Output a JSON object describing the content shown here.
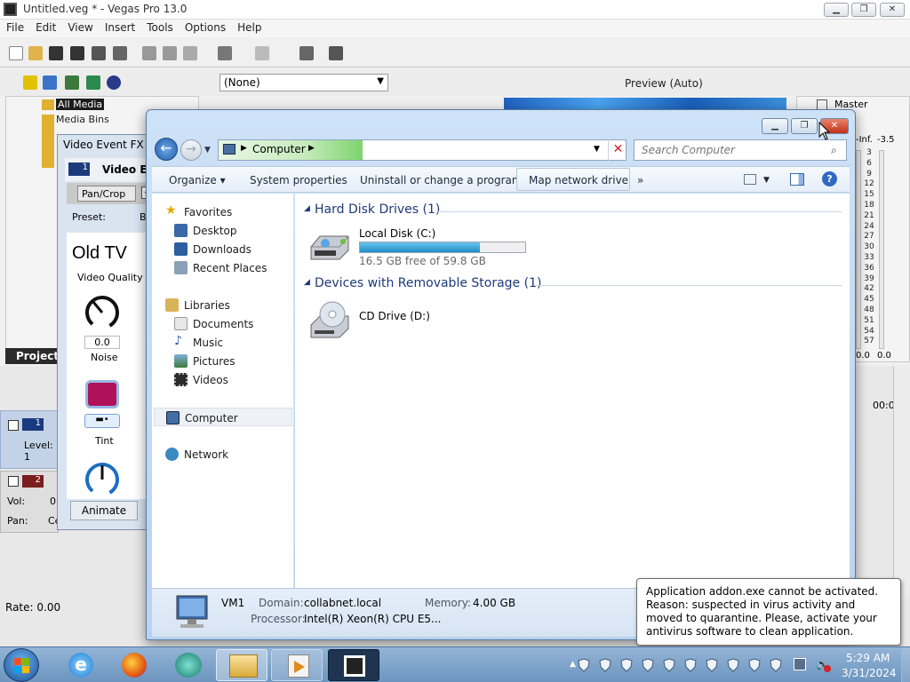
{
  "vegas": {
    "title": "Untitled.veg * - Vegas Pro 13.0",
    "menu": [
      "File",
      "Edit",
      "View",
      "Insert",
      "Tools",
      "Options",
      "Help"
    ],
    "fx_preset": "(None)",
    "preview_label": "Preview (Auto)",
    "master_label": "Master",
    "media_tree": [
      "All Media",
      "Media Bins"
    ],
    "project_tab": "Project",
    "rate_label": "Rate: 0.00",
    "meter_top": [
      "-Inf.",
      "-3.5"
    ],
    "meter_scale": [
      "3",
      "6",
      "9",
      "12",
      "15",
      "18",
      "21",
      "24",
      "27",
      "30",
      "33",
      "36",
      "39",
      "42",
      "45",
      "48",
      "51",
      "54",
      "57"
    ],
    "meter_bottom": [
      "0.0",
      "0.0"
    ],
    "timecode": "00:0",
    "tracks": [
      {
        "num": "1",
        "label": "Level: 1"
      },
      {
        "num": "2",
        "label": "Vol:",
        "value": "0",
        "pan_label": "Pan:",
        "pan_value": "Ce"
      }
    ]
  },
  "fx_window": {
    "title": "Video Event FX",
    "chain_label": "Video Eve",
    "chain_num": "1",
    "pan_crop": "Pan/Crop",
    "preset_label": "Preset:",
    "preset_value": "Bi",
    "plugin_name": "Old TV",
    "video_quality": "Video Quality",
    "noise_value": "0.0",
    "noise_label": "Noise",
    "tint_label": "Tint",
    "animate_button": "Animate",
    "tint_color": "#b0125a"
  },
  "explorer": {
    "breadcrumb": "Computer",
    "search_placeholder": "Search Computer",
    "commands": [
      "Organize",
      "System properties",
      "Uninstall or change a program",
      "Map network drive"
    ],
    "nav": {
      "favorites": "Favorites",
      "favorite_items": [
        "Desktop",
        "Downloads",
        "Recent Places"
      ],
      "libraries": "Libraries",
      "library_items": [
        "Documents",
        "Music",
        "Pictures",
        "Videos"
      ],
      "computer": "Computer",
      "network": "Network"
    },
    "groups": [
      {
        "header": "Hard Disk Drives (1)"
      },
      {
        "header": "Devices with Removable Storage (1)"
      }
    ],
    "local_disk": {
      "name": "Local Disk (C:)",
      "free": "16.5 GB free of 59.8 GB",
      "used_fraction": 0.724
    },
    "cd_drive": {
      "name": "CD Drive (D:)"
    },
    "details": {
      "name": "VM1",
      "domain_label": "Domain:",
      "domain": "collabnet.local",
      "memory_label": "Memory:",
      "memory": "4.00 GB",
      "processor_label": "Processor:",
      "processor": "Intel(R) Xeon(R) CPU E5..."
    }
  },
  "notification": {
    "text": "Application addon.exe cannot be activated. Reason: suspected in virus activity and moved to quarantine. Please, activate your antivirus software to clean application."
  },
  "taskbar": {
    "time": "5:29 AM",
    "date": "3/31/2024"
  }
}
